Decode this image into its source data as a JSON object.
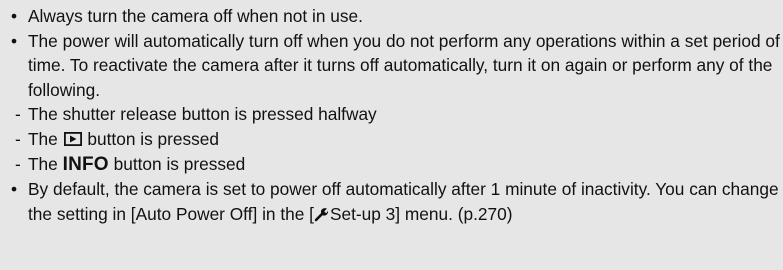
{
  "notes": {
    "bullet_symbol": "•",
    "dash_symbol": "-",
    "item1": "Always turn the camera off when not in use.",
    "item2": "The power will automatically turn off when you do not perform any operations within a set period of time. To reactivate the camera after it turns off automatically, turn it on again or perform any of the following.",
    "sub1": "The shutter release button is pressed halfway",
    "sub2_prefix": "The",
    "sub2_suffix": "button is pressed",
    "sub3_prefix": "The",
    "sub3_bold": "INFO",
    "sub3_suffix": "button is pressed",
    "item3_part1": "By default, the camera is set to power off automatically after 1 minute of inactivity. You can change the setting in [Auto Power Off] in the [",
    "item3_menu": "Set-up 3",
    "item3_part2": "] menu. (p.270)"
  },
  "icons": {
    "playback": "playback-button-icon",
    "setup": "wrench-icon"
  }
}
